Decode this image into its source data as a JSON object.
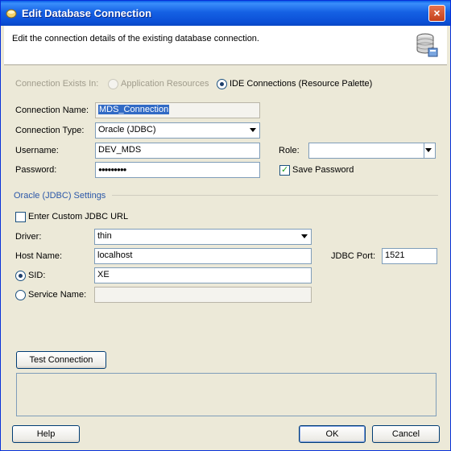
{
  "window": {
    "title": "Edit Database Connection",
    "close_label": "×"
  },
  "header": {
    "description": "Edit the connection details of the existing database connection."
  },
  "exists_in": {
    "label": "Connection Exists In:",
    "option_app": "Application Resources",
    "option_ide": "IDE Connections (Resource Palette)"
  },
  "form": {
    "name_label": "Connection Name:",
    "name_value": "MDS_Connection",
    "type_label": "Connection Type:",
    "type_value": "Oracle (JDBC)",
    "username_label": "Username:",
    "username_value": "DEV_MDS",
    "password_label": "Password:",
    "password_value": "●●●●●●●●●",
    "role_label": "Role:",
    "role_value": "",
    "save_password_label": "Save Password"
  },
  "settings": {
    "section_title": "Oracle (JDBC) Settings",
    "custom_url_label": "Enter Custom JDBC URL",
    "driver_label": "Driver:",
    "driver_value": "thin",
    "host_label": "Host Name:",
    "host_value": "localhost",
    "port_label": "JDBC Port:",
    "port_value": "1521",
    "sid_label": "SID:",
    "sid_value": "XE",
    "service_label": "Service Name:",
    "service_value": ""
  },
  "buttons": {
    "test": "Test Connection",
    "help": "Help",
    "ok": "OK",
    "cancel": "Cancel"
  }
}
